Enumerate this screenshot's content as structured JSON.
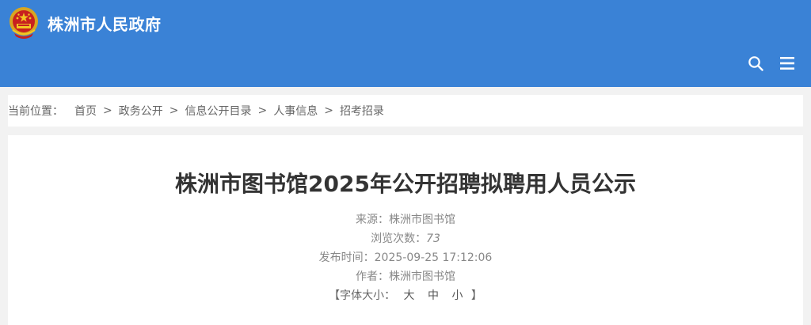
{
  "header": {
    "site_title": "株洲市人民政府",
    "bg_color": "#3a82d6",
    "emblem_icon": "national-emblem-icon",
    "search_icon": "search-icon",
    "menu_icon": "menu-icon"
  },
  "breadcrumb": {
    "label": "当前位置：",
    "separator": ">",
    "items": [
      "首页",
      "政务公开",
      "信息公开目录",
      "人事信息",
      "招考招录"
    ]
  },
  "article": {
    "title": "株洲市图书馆2025年公开招聘拟聘用人员公示",
    "source_label": "来源：",
    "source": "株洲市图书馆",
    "views_label": "浏览次数：",
    "views": "73",
    "published_label": "发布时间：",
    "published": "2025-09-25 17:12:06",
    "author_label": "作者：",
    "author": "株洲市图书馆",
    "font_size": {
      "open": "【",
      "label": "字体大小：",
      "large": "大",
      "medium": "中",
      "small": "小",
      "close": "】"
    }
  }
}
